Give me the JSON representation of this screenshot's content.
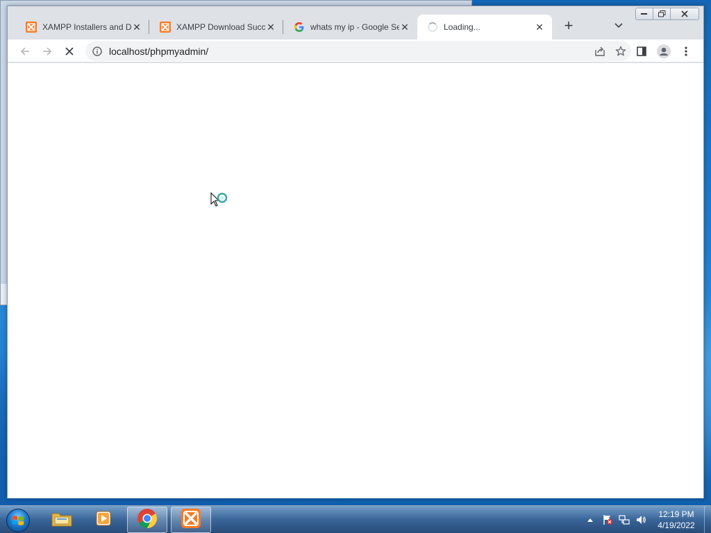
{
  "browser": {
    "tabs": [
      {
        "title": "XAMPP Installers and Do",
        "favicon": "xampp-icon",
        "active": false
      },
      {
        "title": "XAMPP Download Succe",
        "favicon": "xampp-icon",
        "active": false
      },
      {
        "title": "whats my ip - Google Se",
        "favicon": "google-icon",
        "active": false
      },
      {
        "title": "Loading...",
        "favicon": "loading-spinner-icon",
        "active": true
      }
    ],
    "new_tab_label": "+",
    "address_bar": {
      "url": "localhost/phpmyadmin/"
    },
    "state": "loading"
  },
  "taskbar": {
    "pinned": [
      "windows-explorer-icon",
      "media-player-icon",
      "chrome-icon",
      "xampp-icon"
    ],
    "clock": {
      "time": "12:19 PM",
      "date": "4/19/2022"
    }
  },
  "colors": {
    "xampp_orange": "#fb7a24",
    "tabstrip_bg": "#dee1e6",
    "omnibox_bg": "#f1f3f4"
  }
}
